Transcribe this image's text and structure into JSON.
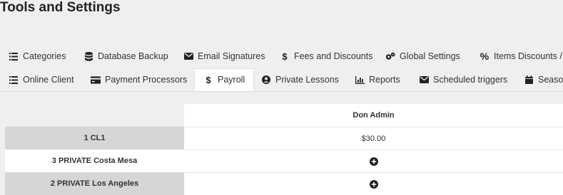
{
  "page": {
    "title": "Tools and Settings"
  },
  "tabs_row1": [
    {
      "label": "Categories",
      "icon": "list-icon"
    },
    {
      "label": "Database Backup",
      "icon": "database-icon"
    },
    {
      "label": "Email Signatures",
      "icon": "envelope-icon"
    },
    {
      "label": "Fees and Discounts",
      "icon": "dollar-icon"
    },
    {
      "label": "Global Settings",
      "icon": "gears-icon"
    },
    {
      "label": "Items Discounts / I",
      "icon": "percent-icon"
    }
  ],
  "tabs_row2": [
    {
      "label": "Online Client",
      "icon": "list-icon"
    },
    {
      "label": "Payment Processors",
      "icon": "credit-card-icon"
    },
    {
      "label": "Payroll",
      "icon": "dollar-icon",
      "active": true
    },
    {
      "label": "Private Lessons",
      "icon": "user-circle-icon"
    },
    {
      "label": "Reports",
      "icon": "bar-chart-icon"
    },
    {
      "label": "Scheduled triggers",
      "icon": "envelope-icon"
    },
    {
      "label": "Season",
      "icon": "calendar-icon"
    }
  ],
  "payroll": {
    "column_header": "Don Admin",
    "rows": [
      {
        "label": "1 CL1",
        "value": "$30.00"
      },
      {
        "label": "3 PRIVATE Costa Mesa",
        "value": "",
        "action_icon": "plus-circle-icon"
      },
      {
        "label": "2 PRIVATE Los Angeles",
        "value": "",
        "action_icon": "plus-circle-icon"
      }
    ]
  }
}
